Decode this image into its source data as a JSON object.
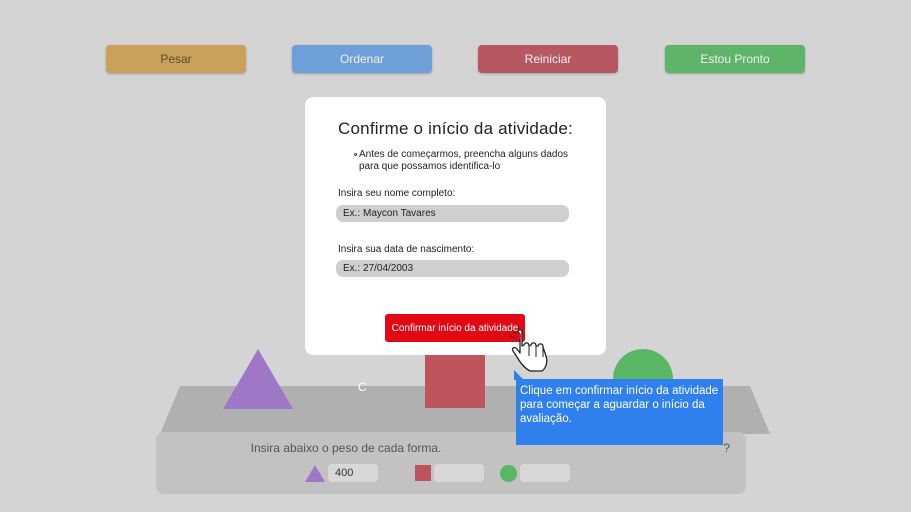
{
  "toolbar": {
    "pesar": "Pesar",
    "ordenar": "Ordenar",
    "reiniciar": "Reiniciar",
    "pronto": "Estou Pronto"
  },
  "board": {
    "table_letter": "C"
  },
  "weights": {
    "label": "Insira abaixo o peso de cada forma.",
    "help": "?",
    "triangle_value": "400",
    "square_value": "",
    "circle_value": ""
  },
  "modal": {
    "title": "Confirme o início da atividade:",
    "bullet": "Antes de começarmos, preencha alguns dados para que possamos identifica-lo",
    "name_label": "Insira seu nome completo:",
    "name_placeholder": "Ex.: Maycon Tavares",
    "birth_label": "Insira sua data de nascimento:",
    "birth_placeholder": "Ex.: 27/04/2003",
    "confirm": "Confirmar início da atividade"
  },
  "tooltip": {
    "text": "Clique em confirmar início da atividade para começar a aguardar o início da avaliação."
  },
  "icons": {
    "hand": "hand-pointer-icon",
    "triangle": "triangle-shape",
    "square": "square-shape",
    "circle": "circle-shape"
  },
  "colors": {
    "pesar": "#c9a15a",
    "ordenar": "#6f9fd8",
    "reiniciar": "#b75761",
    "pronto": "#5eb56a",
    "confirm": "#e10a14",
    "tooltip": "#2f80ed"
  }
}
